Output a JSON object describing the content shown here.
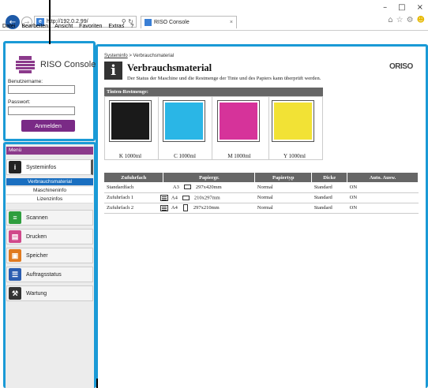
{
  "browser": {
    "url": "http://192.0.2.99/",
    "tab_title": "RISO Console",
    "menu": [
      "Datei",
      "Bearbeiten",
      "Ansicht",
      "Favoriten",
      "Extras",
      "?"
    ]
  },
  "login": {
    "logo_text": "RISO Console",
    "username_label": "Benutzername:",
    "password_label": "Passwort:",
    "login_button": "Anmelden"
  },
  "sidebar": {
    "menu_header": "Menü",
    "items": [
      {
        "label": "Systeminfos",
        "color": "#222222"
      },
      {
        "label": "Scannen",
        "color": "#2e9e3e"
      },
      {
        "label": "Drucken",
        "color": "#d0488a"
      },
      {
        "label": "Speicher",
        "color": "#e07a20"
      },
      {
        "label": "Auftragsstatus",
        "color": "#2a5db0"
      },
      {
        "label": "Wartung",
        "color": "#333333"
      }
    ],
    "subitems": [
      "Verbrauchsmaterial",
      "Maschineninfo",
      "Lizenzinfos"
    ]
  },
  "content": {
    "breadcrumb_link": "Systeminfo",
    "breadcrumb_sep": " > ",
    "breadcrumb_current": "Verbrauchsmaterial",
    "title_icon": "i",
    "title": "Verbrauchsmaterial",
    "description": "Der Status der Maschine und die Restmenge der Tinte und des Papiers kann überprüft werden.",
    "brand": "ORISO"
  },
  "ink": {
    "header": "Tinten-Restmenge:",
    "colors": [
      {
        "label": "K 1000ml",
        "hex": "#1a1a1a"
      },
      {
        "label": "C 1000ml",
        "hex": "#2ab6e6"
      },
      {
        "label": "M 1000ml",
        "hex": "#d6339a"
      },
      {
        "label": "Y 1000ml",
        "hex": "#f2e235"
      }
    ]
  },
  "trays": {
    "headers": [
      "Zufuhrfach",
      "Papiergr.",
      "Papiertyp",
      "Dicke",
      "Auto. Ausw."
    ],
    "rows": [
      {
        "name": "Standardfach",
        "size": "A3",
        "dims": "297x420mm",
        "type": "Normal",
        "thickness": "Standard",
        "auto": "ON",
        "icon": false,
        "orient": "landscape"
      },
      {
        "name": "Zufuhrfach 1",
        "size": "A4",
        "dims": "210x297mm",
        "type": "Normal",
        "thickness": "Standard",
        "auto": "ON",
        "icon": true,
        "orient": "landscape"
      },
      {
        "name": "Zufuhrfach 2",
        "size": "A4",
        "dims": "297x210mm",
        "type": "Normal",
        "thickness": "Standard",
        "auto": "ON",
        "icon": true,
        "orient": "portrait"
      }
    ]
  }
}
